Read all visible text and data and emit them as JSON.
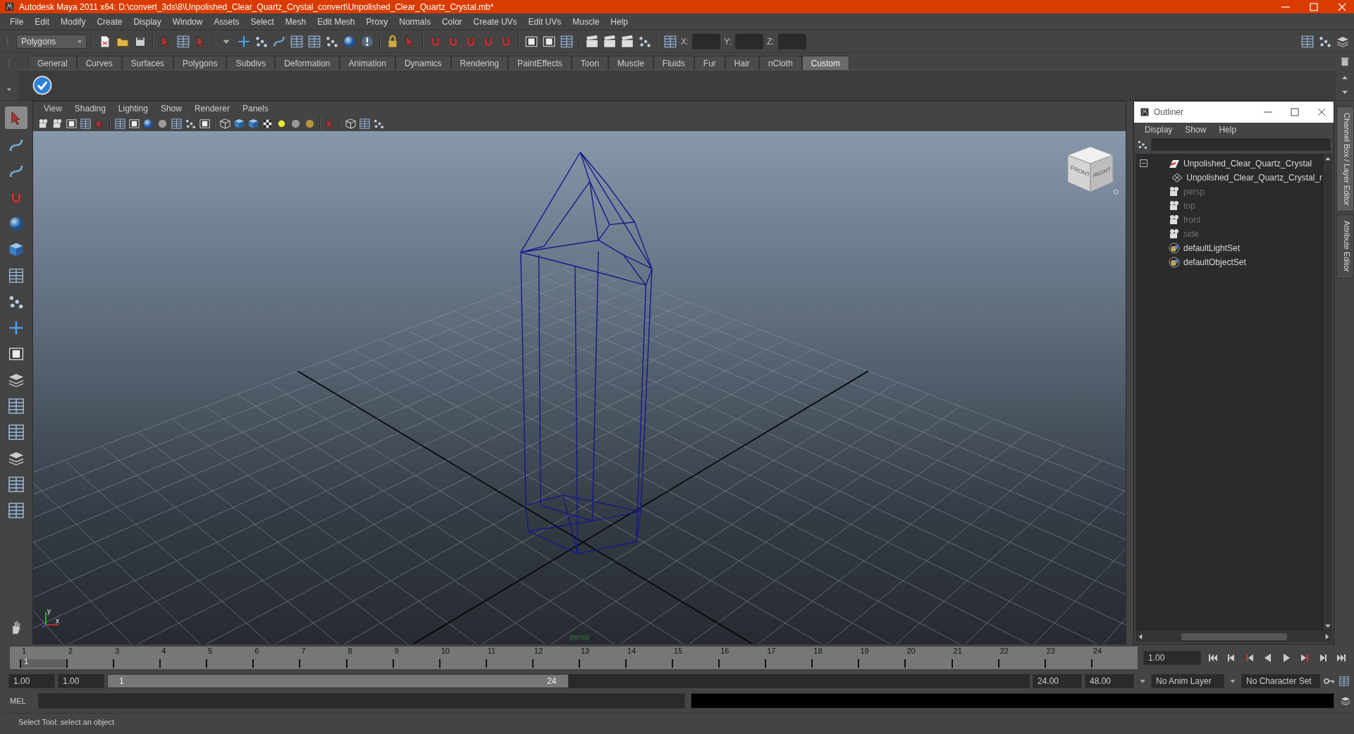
{
  "window": {
    "title": "Autodesk Maya 2011 x64: D:\\convert_3ds\\8\\Unpolished_Clear_Quartz_Crystal_convert\\Unpolished_Clear_Quartz_Crystal.mb*"
  },
  "menu": [
    "File",
    "Edit",
    "Modify",
    "Create",
    "Display",
    "Window",
    "Assets",
    "Select",
    "Mesh",
    "Edit Mesh",
    "Proxy",
    "Normals",
    "Color",
    "Create UVs",
    "Edit UVs",
    "Muscle",
    "Help"
  ],
  "status_line": {
    "mode": "Polygons",
    "fields": [
      "X:",
      "Y:",
      "Z:"
    ]
  },
  "shelf": {
    "tabs": [
      {
        "label": "General",
        "selected": false
      },
      {
        "label": "Curves",
        "selected": false
      },
      {
        "label": "Surfaces",
        "selected": false
      },
      {
        "label": "Polygons",
        "selected": false
      },
      {
        "label": "Subdivs",
        "selected": false
      },
      {
        "label": "Deformation",
        "selected": false
      },
      {
        "label": "Animation",
        "selected": false
      },
      {
        "label": "Dynamics",
        "selected": false
      },
      {
        "label": "Rendering",
        "selected": false
      },
      {
        "label": "PaintEffects",
        "selected": false
      },
      {
        "label": "Toon",
        "selected": false
      },
      {
        "label": "Muscle",
        "selected": false
      },
      {
        "label": "Fluids",
        "selected": false
      },
      {
        "label": "Fur",
        "selected": false
      },
      {
        "label": "Hair",
        "selected": false
      },
      {
        "label": "nCloth",
        "selected": false
      },
      {
        "label": "Custom",
        "selected": true
      }
    ]
  },
  "viewport": {
    "menu": [
      "View",
      "Shading",
      "Lighting",
      "Show",
      "Renderer",
      "Panels"
    ],
    "camera": "persp",
    "viewcube": [
      "FRONT",
      "RIGHT"
    ],
    "axis": [
      "y",
      "x"
    ]
  },
  "outliner": {
    "title": "Outliner",
    "menu": [
      "Display",
      "Show",
      "Help"
    ],
    "items": [
      {
        "label": "Unpolished_Clear_Quartz_Crystal",
        "kind": "transform",
        "dimmed": false,
        "expanded": true,
        "children": [
          {
            "label": "Unpolished_Clear_Quartz_Crystal_r",
            "kind": "shape",
            "dimmed": false
          }
        ]
      },
      {
        "label": "persp",
        "kind": "camera",
        "dimmed": true
      },
      {
        "label": "top",
        "kind": "camera",
        "dimmed": true
      },
      {
        "label": "front",
        "kind": "camera",
        "dimmed": true
      },
      {
        "label": "side",
        "kind": "camera",
        "dimmed": true
      },
      {
        "label": "defaultLightSet",
        "kind": "set",
        "dimmed": false
      },
      {
        "label": "defaultObjectSet",
        "kind": "set",
        "dimmed": false
      }
    ]
  },
  "side_tabs": [
    {
      "label": "Channel Box / Layer Editor",
      "selected": true
    },
    {
      "label": "Attribute Editor",
      "selected": false
    }
  ],
  "timeline": {
    "ticks": [
      {
        "label": "1",
        "selected": true
      },
      {
        "label": "2",
        "selected": false
      },
      {
        "label": "3",
        "selected": false
      },
      {
        "label": "4",
        "selected": false
      },
      {
        "label": "5",
        "selected": false
      },
      {
        "label": "6",
        "selected": false
      },
      {
        "label": "7",
        "selected": false
      },
      {
        "label": "8",
        "selected": false
      },
      {
        "label": "9",
        "selected": false
      },
      {
        "label": "10",
        "selected": false
      },
      {
        "label": "11",
        "selected": false
      },
      {
        "label": "12",
        "selected": false
      },
      {
        "label": "13",
        "selected": false
      },
      {
        "label": "14",
        "selected": false
      },
      {
        "label": "15",
        "selected": false
      },
      {
        "label": "16",
        "selected": false
      },
      {
        "label": "17",
        "selected": false
      },
      {
        "label": "18",
        "selected": false
      },
      {
        "label": "19",
        "selected": false
      },
      {
        "label": "20",
        "selected": false
      },
      {
        "label": "21",
        "selected": false
      },
      {
        "label": "22",
        "selected": false
      },
      {
        "label": "23",
        "selected": false
      },
      {
        "label": "24",
        "selected": false
      }
    ],
    "current": "1",
    "current_time": "1.00"
  },
  "range": {
    "level": 0.5,
    "start": "1.00",
    "playback_start": "1.00",
    "slider_start": "1",
    "slider_end": "24",
    "playback_end": "24.00",
    "end": "48.00",
    "anim_layer": "No Anim Layer",
    "character_set": "No Character Set"
  },
  "command_line": {
    "label": "MEL"
  },
  "help_line": "Select Tool: select an object"
}
